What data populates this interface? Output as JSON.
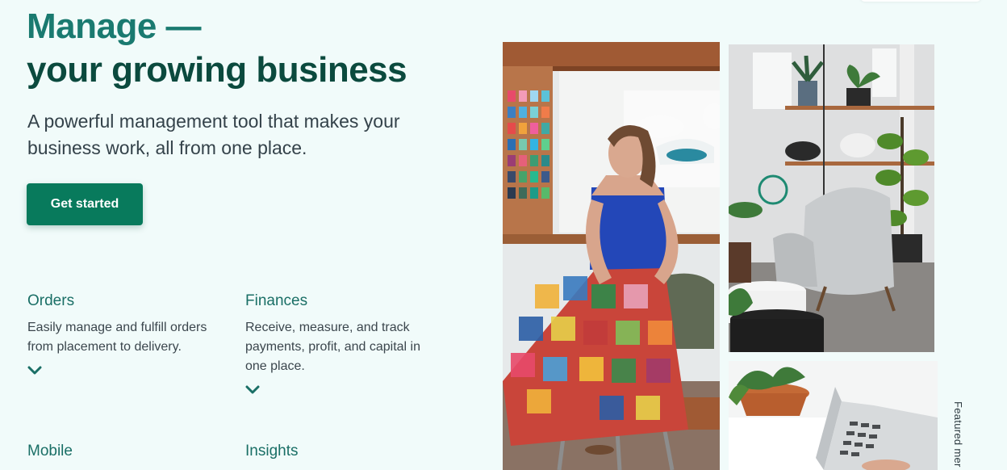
{
  "hero": {
    "title_line1": "Manage —",
    "title_line2": "your growing business",
    "subtitle": "A powerful management tool that makes your business work, all from one place.",
    "cta_label": "Get started"
  },
  "features": [
    {
      "title": "Orders",
      "description": "Easily manage and fulfill orders from placement to delivery.",
      "toggle_icon": "chevron-down-icon"
    },
    {
      "title": "Finances",
      "description": "Receive, measure, and track payments, profit, and capital in one place.",
      "toggle_icon": "chevron-down-icon"
    },
    {
      "title": "Mobile"
    },
    {
      "title": "Insights"
    }
  ],
  "gallery": {
    "caption": "Featured mer"
  },
  "colors": {
    "background": "#f1fbfa",
    "accent": "#087a5c",
    "title_teal": "#1a7a70",
    "title_dark": "#0b4a3e"
  }
}
